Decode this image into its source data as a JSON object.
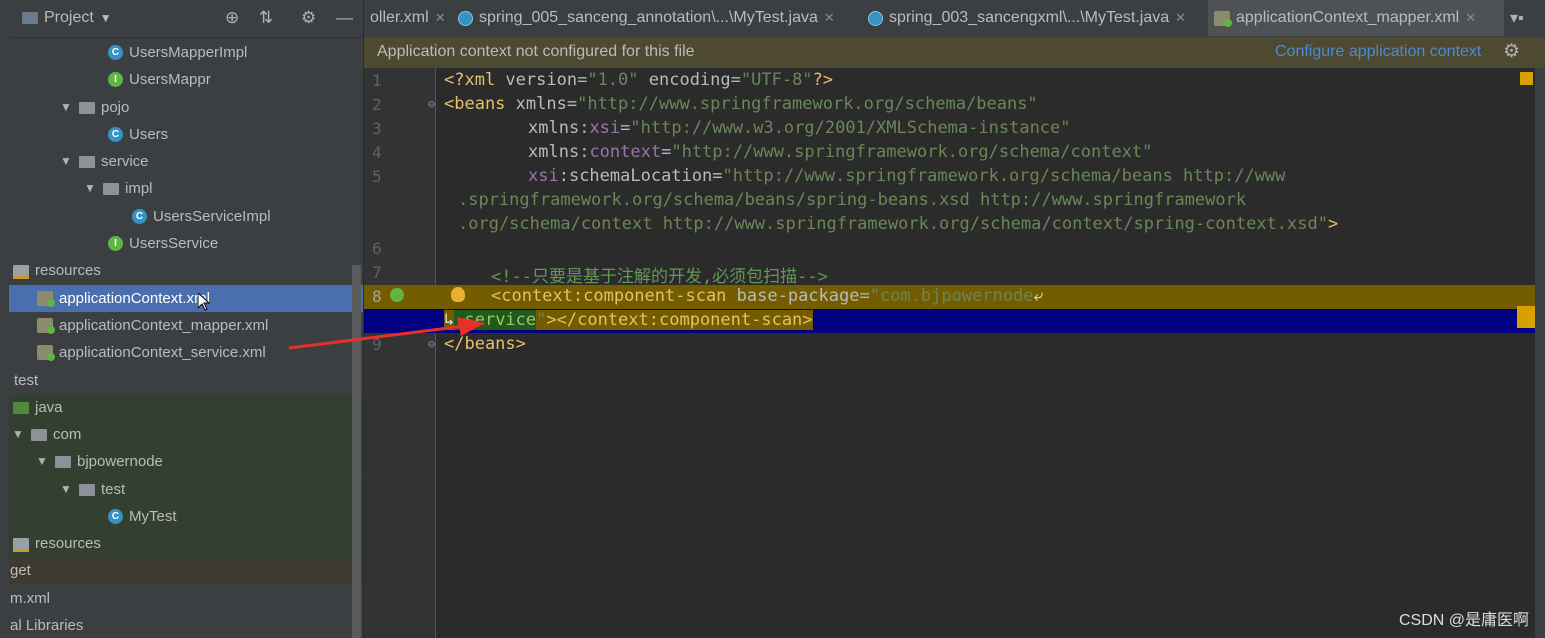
{
  "project_panel": {
    "title": "Project",
    "items": [
      {
        "label": "UsersMapperImpl",
        "kind": "class"
      },
      {
        "label": "UsersMappr",
        "kind": "interface"
      },
      {
        "label": "pojo",
        "kind": "package"
      },
      {
        "label": "Users",
        "kind": "class"
      },
      {
        "label": "service",
        "kind": "package"
      },
      {
        "label": "impl",
        "kind": "package"
      },
      {
        "label": "UsersServiceImpl",
        "kind": "class"
      },
      {
        "label": "UsersService",
        "kind": "interface"
      },
      {
        "label": "resources",
        "kind": "resources-folder"
      },
      {
        "label": "applicationContext.xml",
        "kind": "xml",
        "selected": true
      },
      {
        "label": "applicationContext_mapper.xml",
        "kind": "xml"
      },
      {
        "label": "applicationContext_service.xml",
        "kind": "xml"
      },
      {
        "label": "test",
        "kind": "folder"
      },
      {
        "label": "java",
        "kind": "source-folder"
      },
      {
        "label": "com",
        "kind": "package"
      },
      {
        "label": "bjpowernode",
        "kind": "package"
      },
      {
        "label": "test",
        "kind": "package"
      },
      {
        "label": "MyTest",
        "kind": "class"
      },
      {
        "label": "resources",
        "kind": "resources-folder"
      },
      {
        "label": "get",
        "kind": "folder"
      },
      {
        "label": "m.xml",
        "kind": "file"
      },
      {
        "label": "al Libraries",
        "kind": "libraries"
      }
    ]
  },
  "tabs": [
    {
      "label": "oller.xml",
      "icon": "xml-icon"
    },
    {
      "label": "spring_005_sanceng_annotation\\...\\MyTest.java",
      "icon": "java-class-icon"
    },
    {
      "label": "spring_003_sancengxml\\...\\MyTest.java",
      "icon": "java-class-icon"
    },
    {
      "label": "applicationContext_mapper.xml",
      "icon": "xml-icon",
      "active": true
    }
  ],
  "notification": {
    "text": "Application context not configured for this file",
    "link": "Configure application context"
  },
  "editor": {
    "line_numbers": [
      "1",
      "2",
      "3",
      "4",
      "5",
      "",
      "",
      "6",
      "7",
      "8",
      "",
      "9"
    ],
    "lines": {
      "l1": {
        "a": "<?xml ",
        "b": "version",
        "c": "=",
        "d": "\"1.0\"",
        "e": " encoding",
        "f": "=",
        "g": "\"UTF-8\"",
        "h": "?>"
      },
      "l2": {
        "a": "<beans ",
        "b": "xmlns",
        "c": "=",
        "d": "\"http://www.springframework.org/schema/beans\""
      },
      "l3": {
        "a": "xmlns",
        "b": ":",
        "c": "xsi",
        "d": "=",
        "e": "\"http://www.w3.org/2001/XMLSchema-instance\""
      },
      "l4": {
        "a": "xmlns",
        "b": ":",
        "c": "context",
        "d": "=",
        "e": "\"http://www.springframework.org/schema/context\""
      },
      "l5": {
        "a": "xsi",
        "b": ":schemaLocation=",
        "c": "\"http://www.springframework.org/schema/beans http://www"
      },
      "l5b": ".springframework.org/schema/beans/spring-beans.xsd http://www.springframework",
      "l5c": ".org/schema/context http://www.springframework.org/schema/context/spring-context.xsd\"",
      "l5c_end": ">",
      "l7": "<!--只要是基于注解的开发,必须包扫描-->",
      "l8": {
        "a": "<context",
        "b": ":component-scan ",
        "c": "base-package",
        "d": "=",
        "e": "\"com.bjpowernode"
      },
      "l8b": {
        "a": ".service",
        "b": "\"",
        "c": "></",
        "d": "context",
        "e": ":component-scan>"
      },
      "l9": "</beans>"
    }
  },
  "watermark": "CSDN @是庸医啊"
}
